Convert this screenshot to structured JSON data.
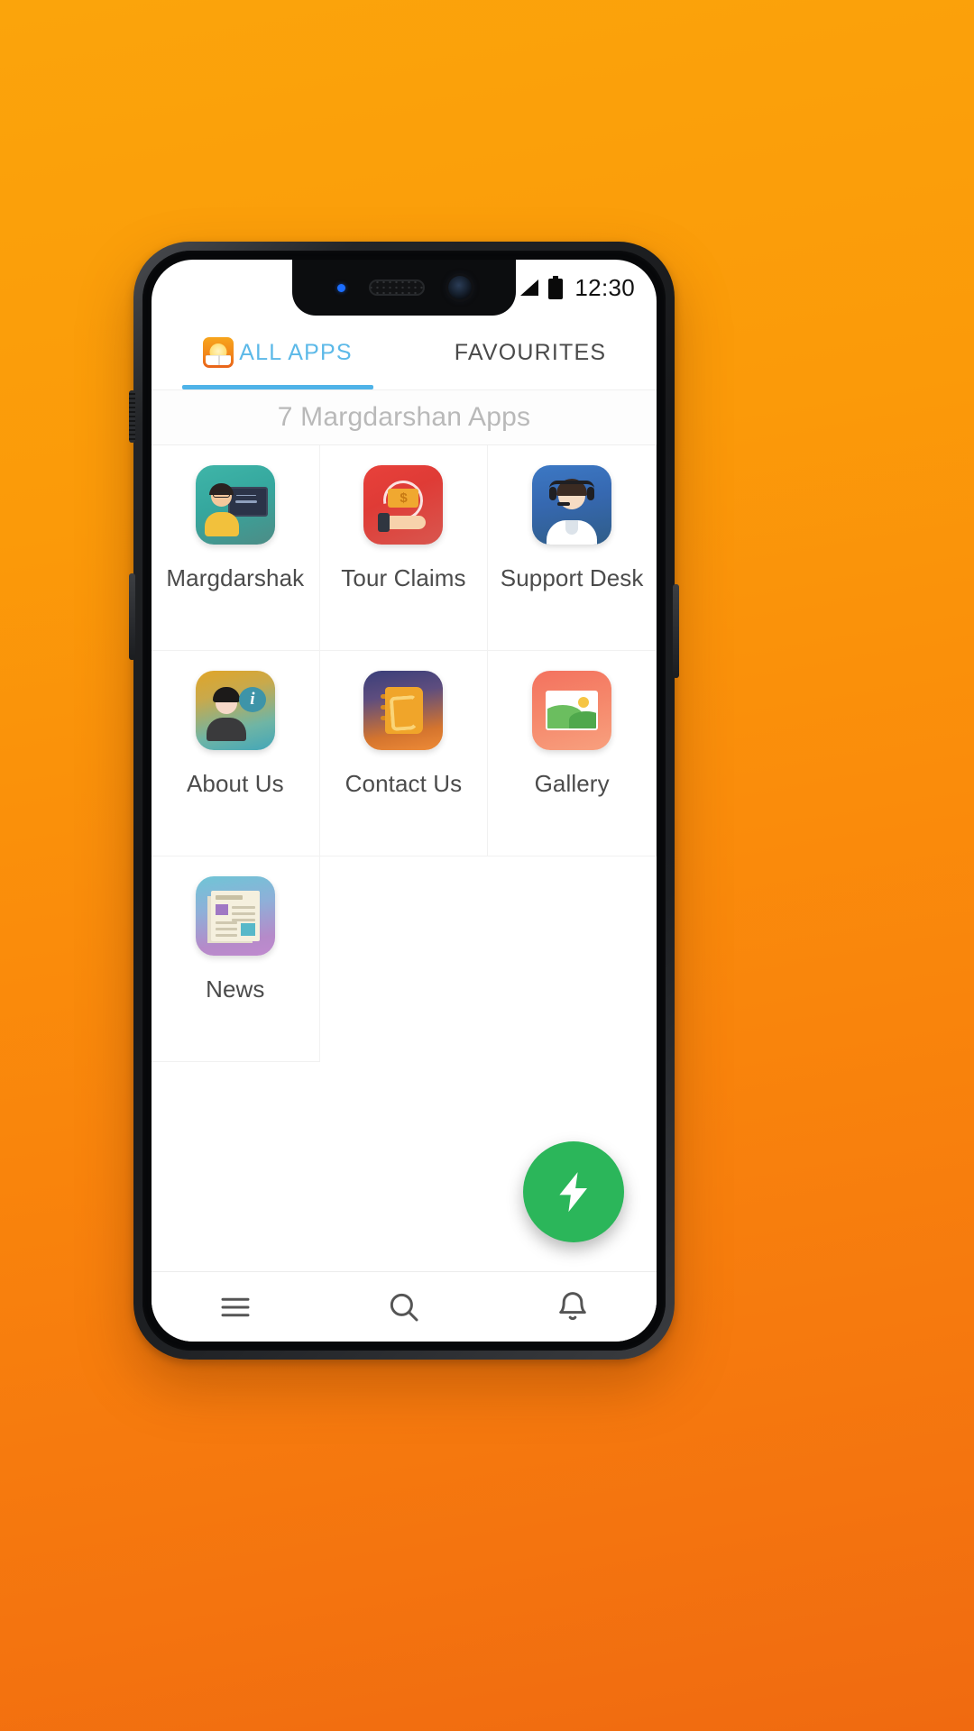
{
  "theme": {
    "background_start": "#FBA40B",
    "background_end": "#F06A10",
    "accent_blue": "#5CB9E8",
    "fab_green": "#2BB65A"
  },
  "statusbar": {
    "wifi_icon": "wifi-icon",
    "signal_icon": "cellular-signal-icon",
    "battery_icon": "battery-full-icon",
    "time": "12:30"
  },
  "tabs": [
    {
      "id": "all-apps",
      "label": "ALL APPS",
      "active": true,
      "icon": "margdarshan-logo-icon"
    },
    {
      "id": "favourites",
      "label": "FAVOURITES",
      "active": false
    }
  ],
  "subheader": {
    "text": "7 Margdarshan Apps"
  },
  "apps": [
    {
      "id": "margdarshak",
      "label": "Margdarshak",
      "icon": "teacher-blackboard-icon"
    },
    {
      "id": "tour-claims",
      "label": "Tour Claims",
      "icon": "hand-money-icon"
    },
    {
      "id": "support-desk",
      "label": "Support Desk",
      "icon": "headset-agent-icon"
    },
    {
      "id": "about-us",
      "label": "About Us",
      "icon": "person-info-icon"
    },
    {
      "id": "contact-us",
      "label": "Contact Us",
      "icon": "phone-book-icon"
    },
    {
      "id": "gallery",
      "label": "Gallery",
      "icon": "photo-landscape-icon"
    },
    {
      "id": "news",
      "label": "News",
      "icon": "newspaper-icon"
    }
  ],
  "fab": {
    "icon": "lightning-bolt-icon",
    "label": "Quick Actions"
  },
  "bottom_nav": [
    {
      "id": "menu",
      "icon": "hamburger-menu-icon"
    },
    {
      "id": "search",
      "icon": "search-icon"
    },
    {
      "id": "notifications",
      "icon": "bell-icon"
    }
  ]
}
